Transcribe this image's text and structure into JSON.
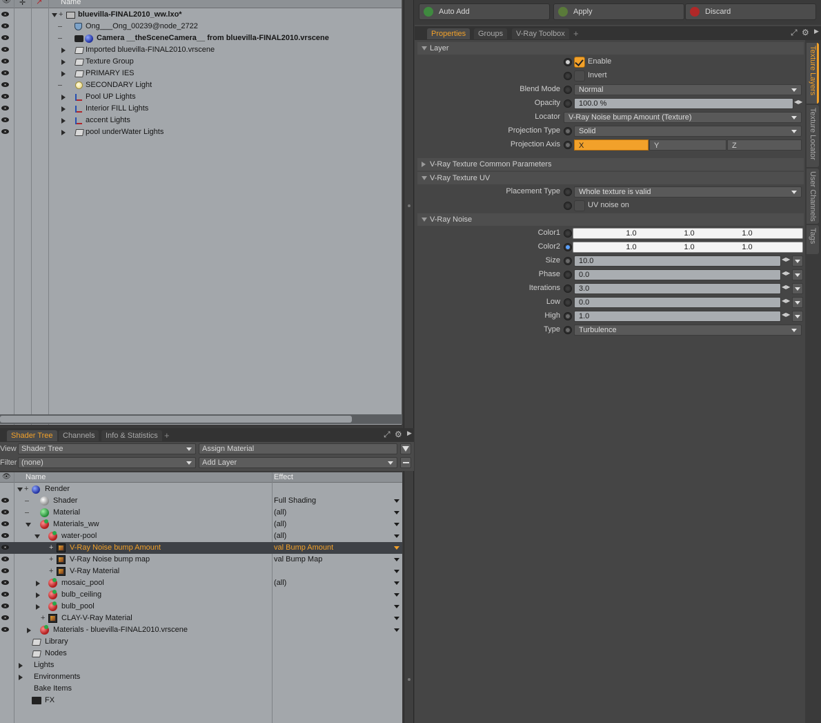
{
  "itemlist": {
    "header_name": "Name",
    "rows": [
      {
        "label": "bluevilla-FINAL2010_ww.lxo*"
      },
      {
        "label": "Ong___Ong_00239@node_2722"
      },
      {
        "label": "Camera __theSceneCamera__ from bluevilla-FINAL2010.vrscene"
      },
      {
        "label": "Imported bluevilla-FINAL2010.vrscene"
      },
      {
        "label": "Texture Group"
      },
      {
        "label": "PRIMARY IES"
      },
      {
        "label": "SECONDARY Light"
      },
      {
        "label": "Pool UP Lights"
      },
      {
        "label": "Interior FILL Lights"
      },
      {
        "label": "accent Lights"
      },
      {
        "label": "pool underWater Lights"
      }
    ]
  },
  "shader_panel": {
    "tabs": [
      "Shader Tree",
      "Channels",
      "Info & Statistics"
    ],
    "tab_plus": "+",
    "view_label": "View",
    "view_value": "Shader Tree",
    "assign_material": "Assign Material",
    "filter_label": "Filter",
    "filter_value": "(none)",
    "add_layer": "Add Layer",
    "col_name": "Name",
    "col_effect": "Effect",
    "rows": [
      {
        "label": "Render",
        "effect": ""
      },
      {
        "label": "Shader",
        "effect": "Full Shading"
      },
      {
        "label": "Material",
        "effect": "(all)"
      },
      {
        "label": "Materials_ww",
        "effect": "(all)"
      },
      {
        "label": "water-pool",
        "effect": "(all)"
      },
      {
        "label": "V-Ray Noise bump Amount",
        "effect": "val Bump Amount"
      },
      {
        "label": "V-Ray Noise bump map",
        "effect": "val Bump Map"
      },
      {
        "label": "V-Ray Material",
        "effect": ""
      },
      {
        "label": "mosaic_pool",
        "effect": "(all)"
      },
      {
        "label": "bulb_ceiling",
        "effect": ""
      },
      {
        "label": "bulb_pool",
        "effect": ""
      },
      {
        "label": "CLAY-V-Ray Material",
        "effect": ""
      },
      {
        "label": "Materials - bluevilla-FINAL2010.vrscene",
        "effect": ""
      },
      {
        "label": "Library",
        "effect": ""
      },
      {
        "label": "Nodes",
        "effect": ""
      },
      {
        "label": "Lights",
        "effect": ""
      },
      {
        "label": "Environments",
        "effect": ""
      },
      {
        "label": "Bake Items",
        "effect": ""
      },
      {
        "label": "FX",
        "effect": ""
      }
    ]
  },
  "toolbar": {
    "auto_add": "Auto Add",
    "apply": "Apply",
    "discard": "Discard"
  },
  "properties_tabs": [
    "Properties",
    "Groups",
    "V-Ray Toolbox"
  ],
  "properties_tab_plus": "+",
  "vertical_tabs": [
    "Texture Layers",
    "Texture Locator",
    "User Channels",
    "Tags"
  ],
  "layer": {
    "title": "Layer",
    "enable": "Enable",
    "invert": "Invert",
    "blend_mode_label": "Blend Mode",
    "blend_mode": "Normal",
    "opacity_label": "Opacity",
    "opacity": "100.0 %",
    "locator_label": "Locator",
    "locator": "V-Ray Noise bump Amount (Texture)",
    "projection_type_label": "Projection Type",
    "projection_type": "Solid",
    "projection_axis_label": "Projection Axis",
    "axis_x": "X",
    "axis_y": "Y",
    "axis_z": "Z"
  },
  "common_params": {
    "title": "V-Ray Texture Common Parameters"
  },
  "texture_uv": {
    "title": "V-Ray Texture UV",
    "placement_type_label": "Placement Type",
    "placement_type": "Whole texture is valid",
    "uv_noise_on": "UV noise on"
  },
  "noise": {
    "title": "V-Ray Noise",
    "color1_label": "Color1",
    "color1": [
      "1.0",
      "1.0",
      "1.0"
    ],
    "color2_label": "Color2",
    "color2": [
      "1.0",
      "1.0",
      "1.0"
    ],
    "size_label": "Size",
    "size": "10.0",
    "phase_label": "Phase",
    "phase": "0.0",
    "iterations_label": "Iterations",
    "iterations": "3.0",
    "low_label": "Low",
    "low": "0.0",
    "high_label": "High",
    "high": "1.0",
    "type_label": "Type",
    "type": "Turbulence"
  },
  "colors": {
    "accent": "#f2a12a",
    "list_bg": "#a3a7ab",
    "panel_bg": "#454545"
  }
}
